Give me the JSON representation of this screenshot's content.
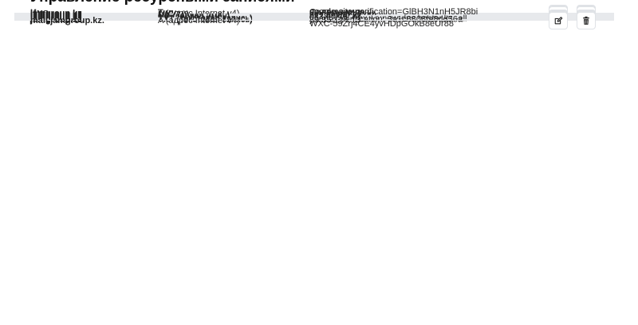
{
  "page": {
    "title": "Управление ресурсными записями"
  },
  "table": {
    "headers": {
      "name": "Имя",
      "type": "Тип",
      "content": "Содержимое"
    },
    "rows": [
      {
        "name": "jamgroup.kz.",
        "type": "A (адрес Internet v4)",
        "content": "89.35.124.13",
        "editable": true
      },
      {
        "name": "jamgroup.kz.",
        "type": "MX (10)",
        "content": "mail.jamgroup.kz.",
        "editable": true
      },
      {
        "name": "jamgroup.kz.",
        "type": "MX (1)",
        "content": "smtp.google.com.",
        "editable": true
      },
      {
        "name": "jamgroup.kz.",
        "type": "NS (сервер имён)",
        "content": "ns1.hoster.kz.",
        "editable": false
      },
      {
        "name": "jamgroup.kz.",
        "type": "NS (сервер имён)",
        "content": "ns2.hoster.kz.",
        "editable": false
      },
      {
        "name": "jamgroup.kz.",
        "type": "NS (сервер имён)",
        "content": "ns3.hoster.kz.",
        "editable": false
      },
      {
        "name": "jamgroup.kz.",
        "type": "TXT (текстовая запись)",
        "content": "google-site-verification=GlBH3N1nH5JR8biWXC-59Zrj4CE4yvHDpGOkB8eUr88",
        "editable": true
      },
      {
        "name": "jamgroup.kz.",
        "type": "TXT (текстовая запись)",
        "content": "v=spf1 +a +mx +a:new-dns.hoster.kz -all",
        "editable": true
      },
      {
        "name": "jamgroup.kz.",
        "type": "TXT (текстовая запись)",
        "content": "yandex-verification: 3a1c8808fa8dd56a",
        "editable": true
      },
      {
        "name": "mail.jamgroup.kz.",
        "type": "A (адрес Internet v4)",
        "content": "89.35.124.13",
        "editable": true
      }
    ]
  },
  "icons": {
    "edit": "edit-icon",
    "delete": "trash-icon"
  }
}
